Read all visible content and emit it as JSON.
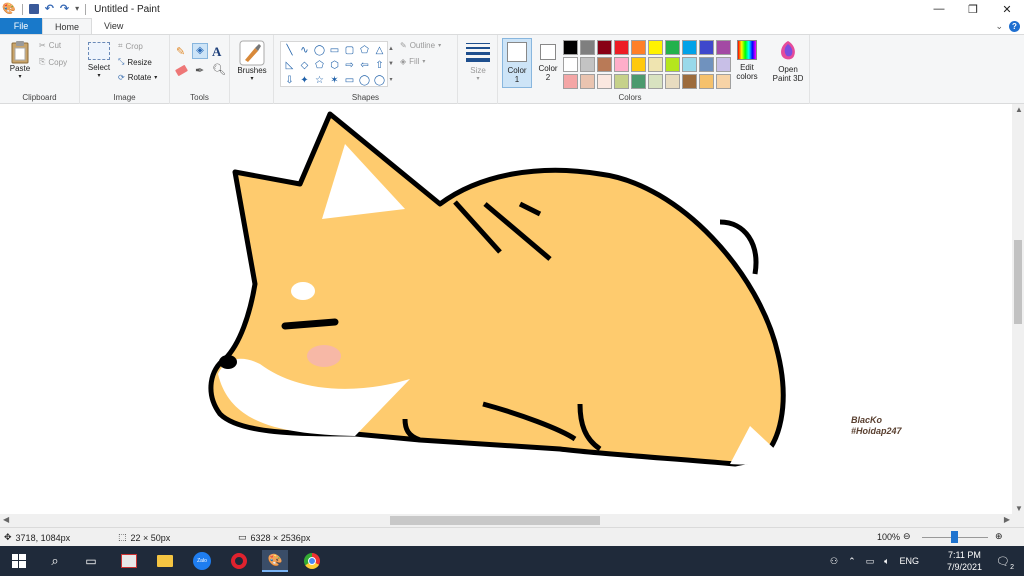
{
  "window": {
    "title": "Untitled - Paint",
    "minimize": "—",
    "restore": "❐",
    "close": "✕"
  },
  "tabs": {
    "file": "File",
    "home": "Home",
    "view": "View"
  },
  "clipboard": {
    "paste": "Paste",
    "cut": "Cut",
    "copy": "Copy",
    "group": "Clipboard"
  },
  "image": {
    "select": "Select",
    "crop": "Crop",
    "resize": "Resize",
    "rotate": "Rotate",
    "group": "Image"
  },
  "tools": {
    "group": "Tools"
  },
  "brushes": {
    "label": "Brushes"
  },
  "shapes": {
    "outline": "Outline",
    "fill": "Fill",
    "group": "Shapes",
    "items": [
      "╲",
      "∿",
      "◯",
      "▭",
      "▢",
      "⬠",
      "△",
      "◺",
      "◇",
      "⬠",
      "⬡",
      "⇨",
      "⇦",
      "⇧",
      "⇩",
      "✦",
      "☆",
      "✶",
      "▭",
      "◯",
      "◯"
    ]
  },
  "size": {
    "label": "Size"
  },
  "colors": {
    "color1_label": "Color",
    "color1_num": "1",
    "color2_label": "Color",
    "color2_num": "2",
    "edit_label": "Edit",
    "edit_label2": "colors",
    "paint3d_label": "Open",
    "paint3d_label2": "Paint 3D",
    "group": "Colors",
    "color1_value": "#ffffff",
    "color2_value": "#ffffff",
    "palette": [
      "#000000",
      "#7f7f7f",
      "#880015",
      "#ed1c24",
      "#ff7f27",
      "#fff200",
      "#22b14c",
      "#00a2e8",
      "#3f48cc",
      "#a349a4",
      "#ffffff",
      "#c3c3c3",
      "#b97a57",
      "#ffaec9",
      "#ffc90e",
      "#efe4b0",
      "#b5e61d",
      "#99d9ea",
      "#7092be",
      "#c8bfe7",
      "#f4a6a6",
      "#eac4b0",
      "#fbe8e0",
      "#c6d18a",
      "#4c9a6e",
      "#d8e2c0",
      "#e8dcc0",
      "#9c6b3c",
      "#f5c16c",
      "#f7d3a6"
    ]
  },
  "canvas": {
    "signature_line1": "BlacKo",
    "signature_line2": "#Hoidap247",
    "fill_color": "#fecb6e",
    "cheek_color": "#f7b8a6"
  },
  "status": {
    "cursor": "3718, 1084px",
    "selection": "22 × 50px",
    "image_size": "6328 × 2536px",
    "zoom": "100%"
  },
  "taskbar": {
    "lang": "ENG",
    "time": "7:11 PM",
    "date": "7/9/2021",
    "notif_count": "2"
  }
}
